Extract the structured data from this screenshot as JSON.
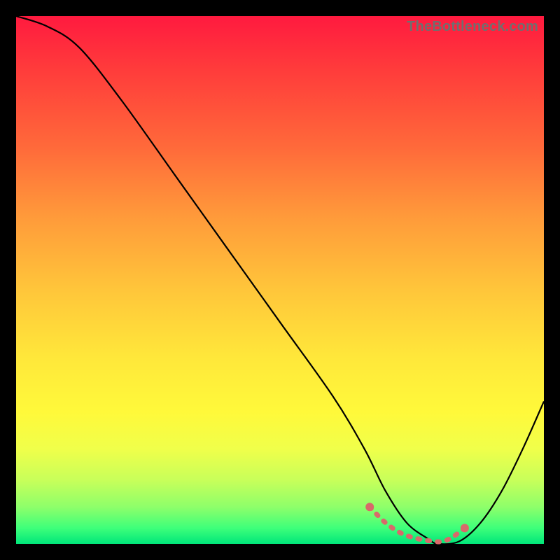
{
  "watermark": "TheBottleneck.com",
  "chart_data": {
    "type": "line",
    "title": "",
    "xlabel": "",
    "ylabel": "",
    "xlim": [
      0,
      100
    ],
    "ylim": [
      0,
      100
    ],
    "series": [
      {
        "name": "bottleneck-curve",
        "x": [
          0,
          6,
          12,
          20,
          30,
          40,
          50,
          60,
          66,
          70,
          74,
          78,
          80,
          84,
          88,
          92,
          96,
          100
        ],
        "values": [
          100,
          98,
          94,
          84,
          70,
          56,
          42,
          28,
          18,
          10,
          4,
          1,
          0,
          0.5,
          4,
          10,
          18,
          27
        ]
      },
      {
        "name": "valley-band",
        "x": [
          67,
          70,
          73,
          76,
          79,
          81,
          83,
          85
        ],
        "values": [
          7,
          4,
          2,
          1,
          0.5,
          0.5,
          1.5,
          3
        ]
      }
    ],
    "markers": {
      "left_end": {
        "x": 67,
        "y": 7
      },
      "right_end": {
        "x": 85,
        "y": 3
      }
    },
    "colors": {
      "curve": "#000000",
      "band": "#d86a6a",
      "gradient_top": "#ff1a3f",
      "gradient_bottom": "#00e67a"
    }
  }
}
